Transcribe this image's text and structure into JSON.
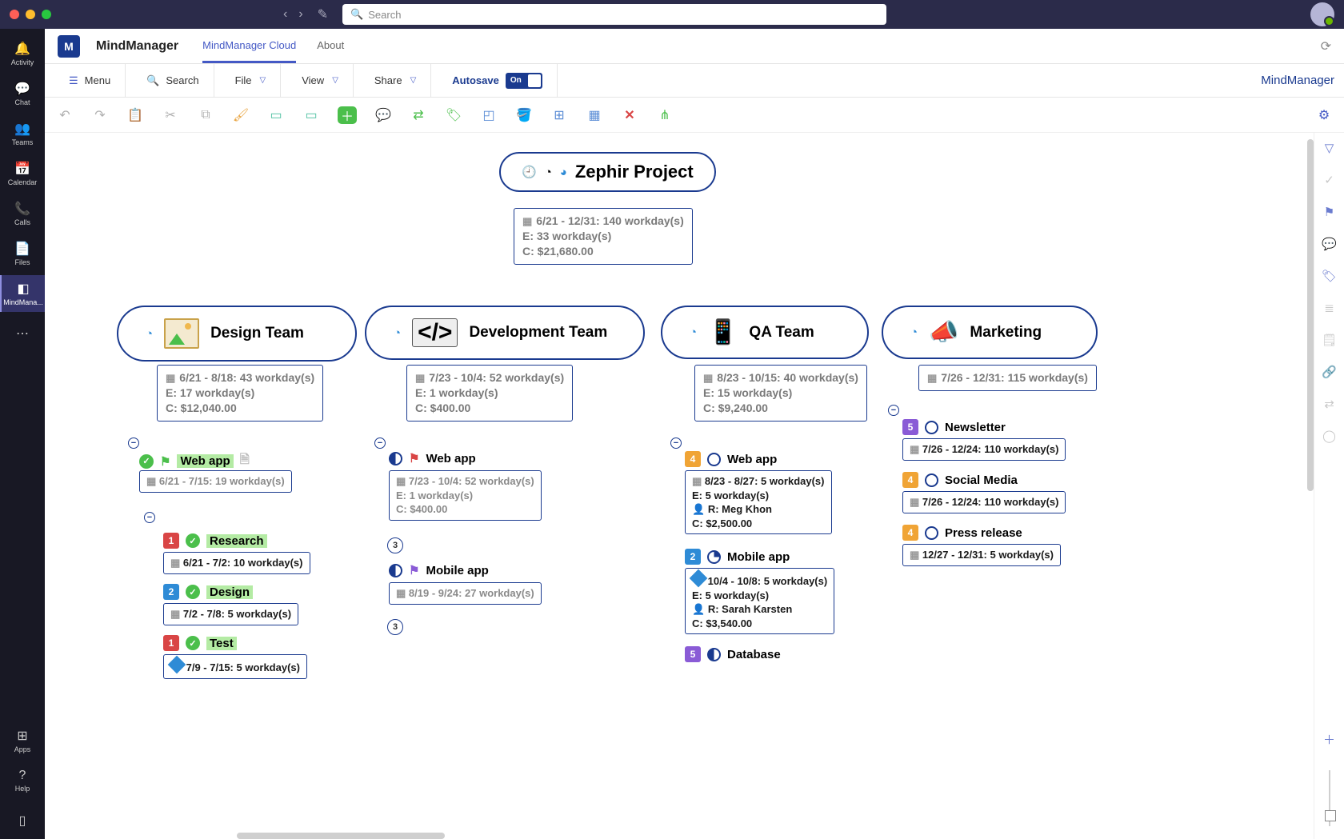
{
  "search_placeholder": "Search",
  "teams_rail": [
    {
      "icon": "🔔",
      "label": "Activity"
    },
    {
      "icon": "💬",
      "label": "Chat"
    },
    {
      "icon": "👥",
      "label": "Teams"
    },
    {
      "icon": "📅",
      "label": "Calendar"
    },
    {
      "icon": "📞",
      "label": "Calls"
    },
    {
      "icon": "📄",
      "label": "Files"
    },
    {
      "icon": "◧",
      "label": "MindMana..."
    }
  ],
  "rail_bottom": [
    {
      "icon": "⊞",
      "label": "Apps"
    },
    {
      "icon": "?",
      "label": "Help"
    }
  ],
  "app": {
    "title": "MindManager",
    "tabs": [
      "MindManager Cloud",
      "About"
    ],
    "active_tab": 0
  },
  "ribbon": {
    "menu": "Menu",
    "search": "Search",
    "file": "File",
    "view": "View",
    "share": "Share",
    "autosave_label": "Autosave",
    "autosave_state": "On",
    "brand": "MindManager"
  },
  "map": {
    "root": {
      "title": "Zephir Project",
      "dates": "6/21 - 12/31: 140 workday(s)",
      "effort": "E: 33 workday(s)",
      "cost": "C: $21,680.00"
    },
    "branches": {
      "design": {
        "title": "Design Team",
        "dates": "6/21 - 8/18: 43 workday(s)",
        "effort": "E: 17 workday(s)",
        "cost": "C: $12,040.00",
        "tasks": [
          {
            "badge": "",
            "title": "Web app",
            "dates": "6/21 - 7/15: 19 workday(s)",
            "hl": true,
            "flag": "green"
          },
          {
            "badge": "1",
            "bc": "red",
            "title": "Research",
            "dates": "6/21 - 7/2: 10 workday(s)",
            "hl": true,
            "chk": true
          },
          {
            "badge": "2",
            "bc": "blue",
            "title": "Design",
            "dates": "7/2 - 7/8: 5 workday(s)",
            "hl": true,
            "chk": true
          },
          {
            "badge": "1",
            "bc": "red",
            "title": "Test",
            "dates": "7/9 - 7/15: 5 workday(s)",
            "hl": true,
            "chk": true,
            "diamond": true
          }
        ]
      },
      "dev": {
        "title": "Development Team",
        "dates": "7/23 - 10/4: 52 workday(s)",
        "effort": "E: 1 workday(s)",
        "cost": "C: $400.00",
        "tasks": [
          {
            "title": "Web app",
            "dates": "7/23 - 10/4: 52 workday(s)",
            "effort": "E: 1 workday(s)",
            "cost": "C: $400.00",
            "flag": "red",
            "half": true,
            "count": "3"
          },
          {
            "title": "Mobile app",
            "dates": "8/19 - 9/24: 27 workday(s)",
            "flag": "purple",
            "half": true,
            "count": "3"
          }
        ]
      },
      "qa": {
        "title": "QA Team",
        "dates": "8/23 - 10/15: 40 workday(s)",
        "effort": "E: 15 workday(s)",
        "cost": "C: $9,240.00",
        "tasks": [
          {
            "badge": "4",
            "bc": "orange",
            "title": "Web app",
            "dates": "8/23 - 8/27: 5 workday(s)",
            "effort": "E: 5 workday(s)",
            "res": "R: Meg Khon",
            "cost": "C: $2,500.00",
            "empty": true
          },
          {
            "badge": "2",
            "bc": "blue",
            "title": "Mobile app",
            "dates": "10/4 - 10/8: 5 workday(s)",
            "effort": "E: 5 workday(s)",
            "res": "R: Sarah Karsten",
            "cost": "C: $3,540.00",
            "qtr": true,
            "diamond": true
          },
          {
            "badge": "5",
            "bc": "purple",
            "title": "Database",
            "half": true
          }
        ]
      },
      "mkt": {
        "title": "Marketing",
        "dates": "7/26 - 12/31: 115 workday(s)",
        "tasks": [
          {
            "badge": "5",
            "bc": "purple",
            "title": "Newsletter",
            "dates": "7/26 - 12/24: 110 workday(s)",
            "empty": true
          },
          {
            "badge": "4",
            "bc": "orange",
            "title": "Social Media",
            "dates": "7/26 - 12/24: 110 workday(s)",
            "empty": true
          },
          {
            "badge": "4",
            "bc": "orange",
            "title": "Press release",
            "dates": "12/27 - 12/31: 5 workday(s)",
            "empty": true
          }
        ]
      }
    }
  }
}
